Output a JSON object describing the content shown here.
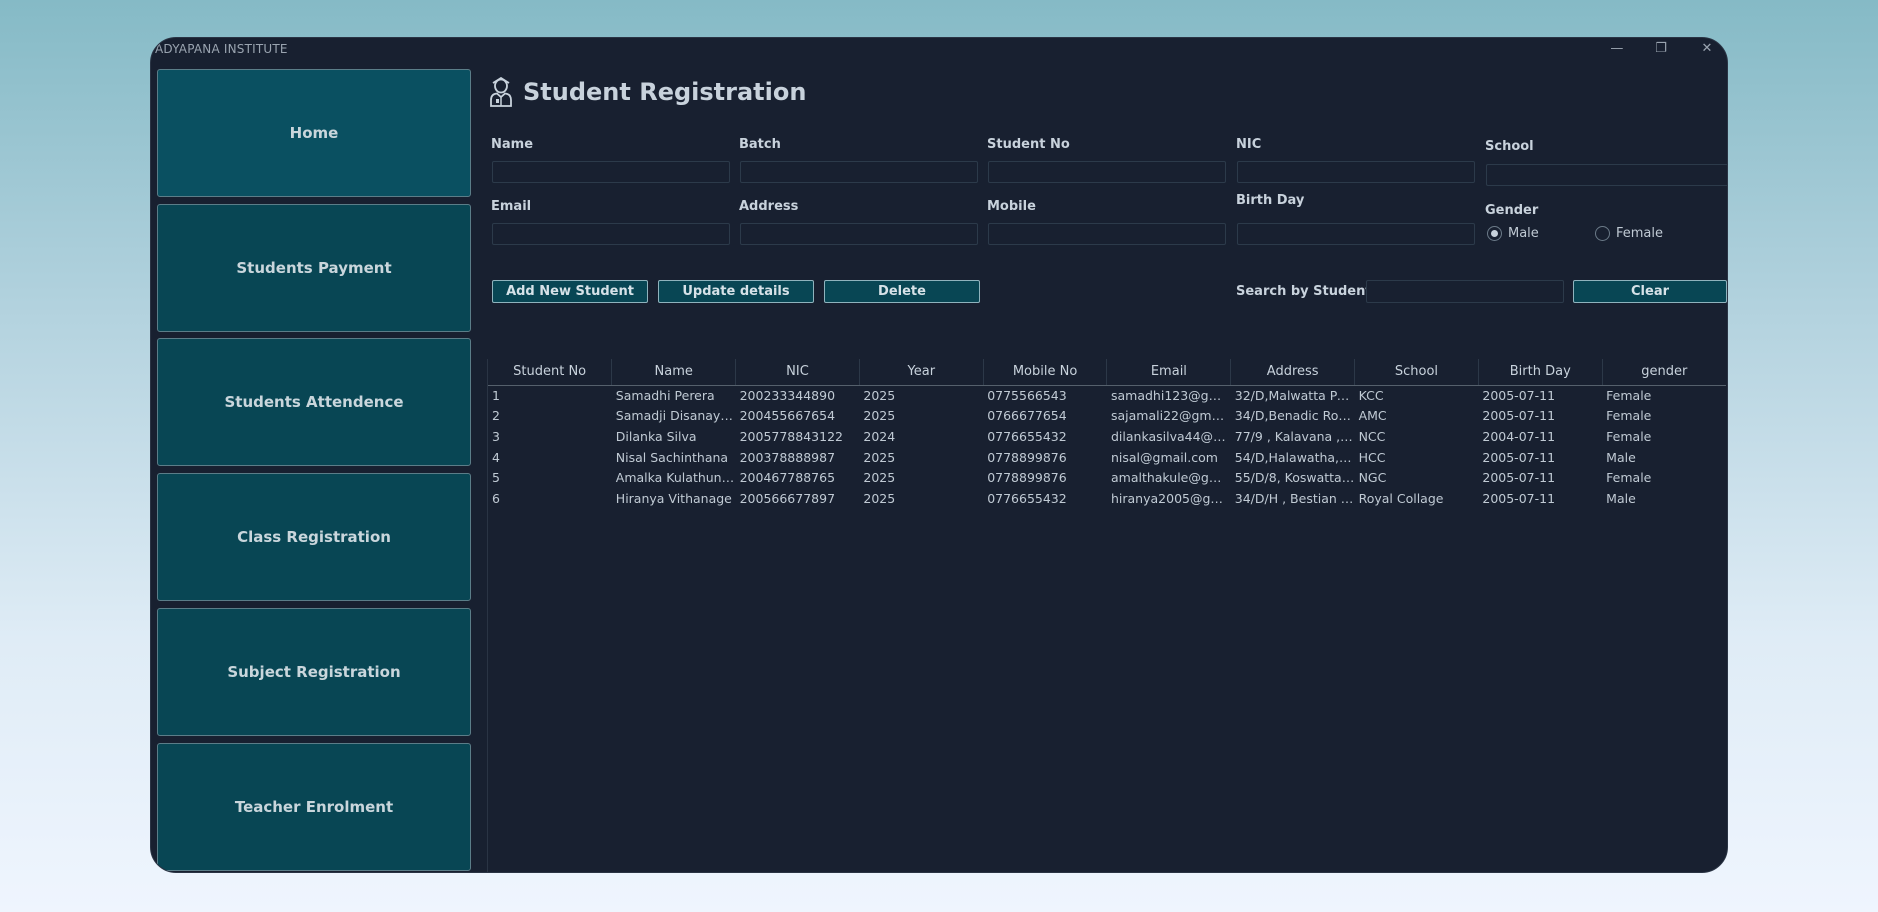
{
  "window": {
    "title": "ADYAPANA INSTITUTE"
  },
  "sidebar": {
    "items": [
      {
        "label": "Home"
      },
      {
        "label": "Students Payment"
      },
      {
        "label": "Students Attendence"
      },
      {
        "label": "Class Registration"
      },
      {
        "label": "Subject Registration"
      },
      {
        "label": "Teacher Enrolment"
      }
    ]
  },
  "page": {
    "title": "Student Registration",
    "icon": "student-icon"
  },
  "form": {
    "name_label": "Name",
    "batch_label": "Batch",
    "student_no_label": "Student No",
    "nic_label": "NIC",
    "school_label": "School",
    "email_label": "Email",
    "address_label": "Address",
    "mobile_label": "Mobile",
    "birthday_label": "Birth Day",
    "gender_label": "Gender",
    "gender_options": [
      {
        "label": "Male",
        "selected": true
      },
      {
        "label": "Female",
        "selected": false
      }
    ],
    "search_label": "Search by Student Id"
  },
  "actions": {
    "add_label": "Add New Student",
    "update_label": "Update details",
    "delete_label": "Delete",
    "clear_label": "Clear"
  },
  "table": {
    "columns": [
      "Student No",
      "Name",
      "NIC",
      "Year",
      "Mobile No",
      "Email",
      "Address",
      "School",
      "Birth Day",
      "gender"
    ],
    "rows": [
      [
        "1",
        "Samadhi Perera",
        "200233344890",
        "2025",
        "0775566543",
        "samadhi123@gmail....",
        "32/D,Malwatta Para ,...",
        "KCC",
        "2005-07-11",
        "Female"
      ],
      [
        "2",
        "Samadji Disanayake",
        "200455667654",
        "2025",
        "0766677654",
        "sajamali22@gmail.c...",
        "34/D,Benadic Road,...",
        "AMC",
        "2005-07-11",
        "Female"
      ],
      [
        "3",
        "Dilanka Silva",
        "2005778843122",
        "2024",
        "0776655432",
        "dilankasilva44@gma...",
        "77/9 , Kalavana , Aw...",
        "NCC",
        "2004-07-11",
        "Female"
      ],
      [
        "4",
        "Nisal Sachinthana",
        "200378888987",
        "2025",
        "0778899876",
        "nisal@gmail.com",
        "54/D,Halawatha,Mat...",
        "HCC",
        "2005-07-11",
        "Male"
      ],
      [
        "5",
        "Amalka Kulathunge",
        "200467788765",
        "2025",
        "0778899876",
        "amalthakule@gmail....",
        "55/D/8, Koswatta , R...",
        "NGC",
        "2005-07-11",
        "Female"
      ],
      [
        "6",
        "Hiranya Vithanage",
        "200566677897",
        "2025",
        "0776655432",
        "hiranya2005@gmail....",
        "34/D/H , Bestian Ro...",
        "Royal Collage",
        "2005-07-11",
        "Male"
      ]
    ]
  }
}
